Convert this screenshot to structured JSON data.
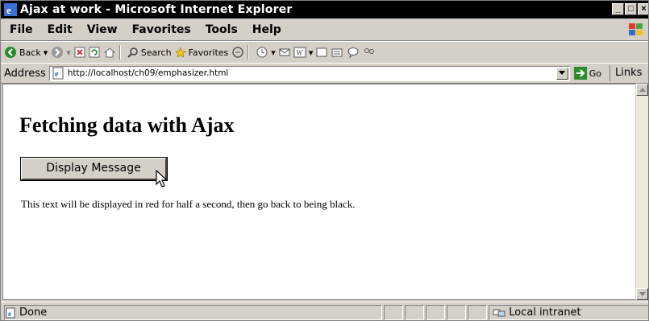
{
  "window": {
    "title": "Ajax at work - Microsoft Internet Explorer"
  },
  "menu": [
    "File",
    "Edit",
    "View",
    "Favorites",
    "Tools",
    "Help"
  ],
  "toolbar": {
    "back": "Back",
    "search": "Search",
    "favorites": "Favorites"
  },
  "address": {
    "label": "Address",
    "url": "http://localhost/ch09/emphasizer.html",
    "go": "Go",
    "links": "Links »"
  },
  "page": {
    "heading": "Fetching data with Ajax",
    "button_label": "Display Message",
    "message": "This text will be displayed in red for half a second, then go back to being black."
  },
  "status": {
    "text": "Done",
    "zone": "Local intranet"
  },
  "colors": {
    "titlebar": "#000000",
    "chrome": "#d4d0c8",
    "ie_blue": "#1c5fbf"
  }
}
